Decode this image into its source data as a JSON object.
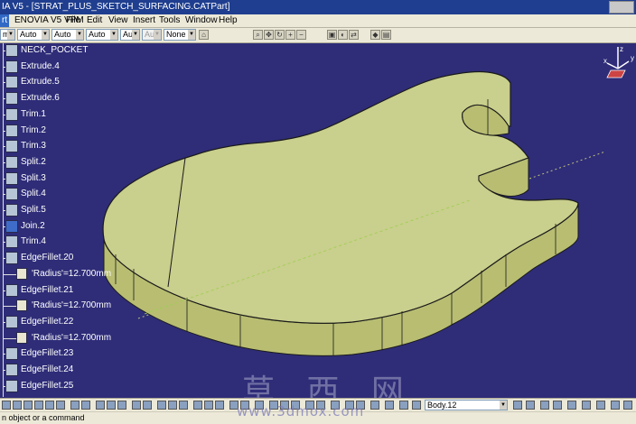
{
  "window": {
    "title": "IA V5 - [STRAT_PLUS_SKETCH_SURFACING.CATPart]"
  },
  "menu": {
    "items": [
      "rt",
      "ENOVIA V5 VPM",
      "File",
      "Edit",
      "View",
      "Insert",
      "Tools",
      "Window",
      "Help"
    ]
  },
  "toolbar": {
    "combos": [
      "ma",
      "Auto",
      "Auto",
      "Auto",
      "Aut",
      "Aut",
      "None"
    ]
  },
  "tree": {
    "nodes": [
      {
        "label": "NECK_POCKET",
        "type": "feature"
      },
      {
        "label": "Extrude.4",
        "type": "feature"
      },
      {
        "label": "Extrude.5",
        "type": "feature"
      },
      {
        "label": "Extrude.6",
        "type": "feature"
      },
      {
        "label": "Trim.1",
        "type": "feature"
      },
      {
        "label": "Trim.2",
        "type": "feature"
      },
      {
        "label": "Trim.3",
        "type": "feature"
      },
      {
        "label": "Split.2",
        "type": "feature"
      },
      {
        "label": "Split.3",
        "type": "feature"
      },
      {
        "label": "Split.4",
        "type": "feature"
      },
      {
        "label": "Split.5",
        "type": "feature"
      },
      {
        "label": "Join.2",
        "type": "join"
      },
      {
        "label": "Trim.4",
        "type": "feature"
      },
      {
        "label": "EdgeFillet.20",
        "type": "feature"
      },
      {
        "label": "'Radius'=12.700mm",
        "type": "param"
      },
      {
        "label": "EdgeFillet.21",
        "type": "feature"
      },
      {
        "label": "'Radius'=12.700mm",
        "type": "param"
      },
      {
        "label": "EdgeFillet.22",
        "type": "feature"
      },
      {
        "label": "'Radius'=12.700mm",
        "type": "param"
      },
      {
        "label": "EdgeFillet.23",
        "type": "feature"
      },
      {
        "label": "EdgeFillet.24",
        "type": "feature"
      },
      {
        "label": "EdgeFillet.25",
        "type": "feature"
      }
    ]
  },
  "compass": {
    "x": "x",
    "y": "y",
    "z": "z"
  },
  "bottom_toolbar": {
    "current_body": "Body.12"
  },
  "status": {
    "text": "n object or a command"
  },
  "watermark": {
    "main": "草 西 网",
    "url": "www.3dmox.com"
  },
  "colors": {
    "background": "#2f2d78",
    "part_face": "#c9cf8c",
    "edge": "#1a1a1a"
  }
}
